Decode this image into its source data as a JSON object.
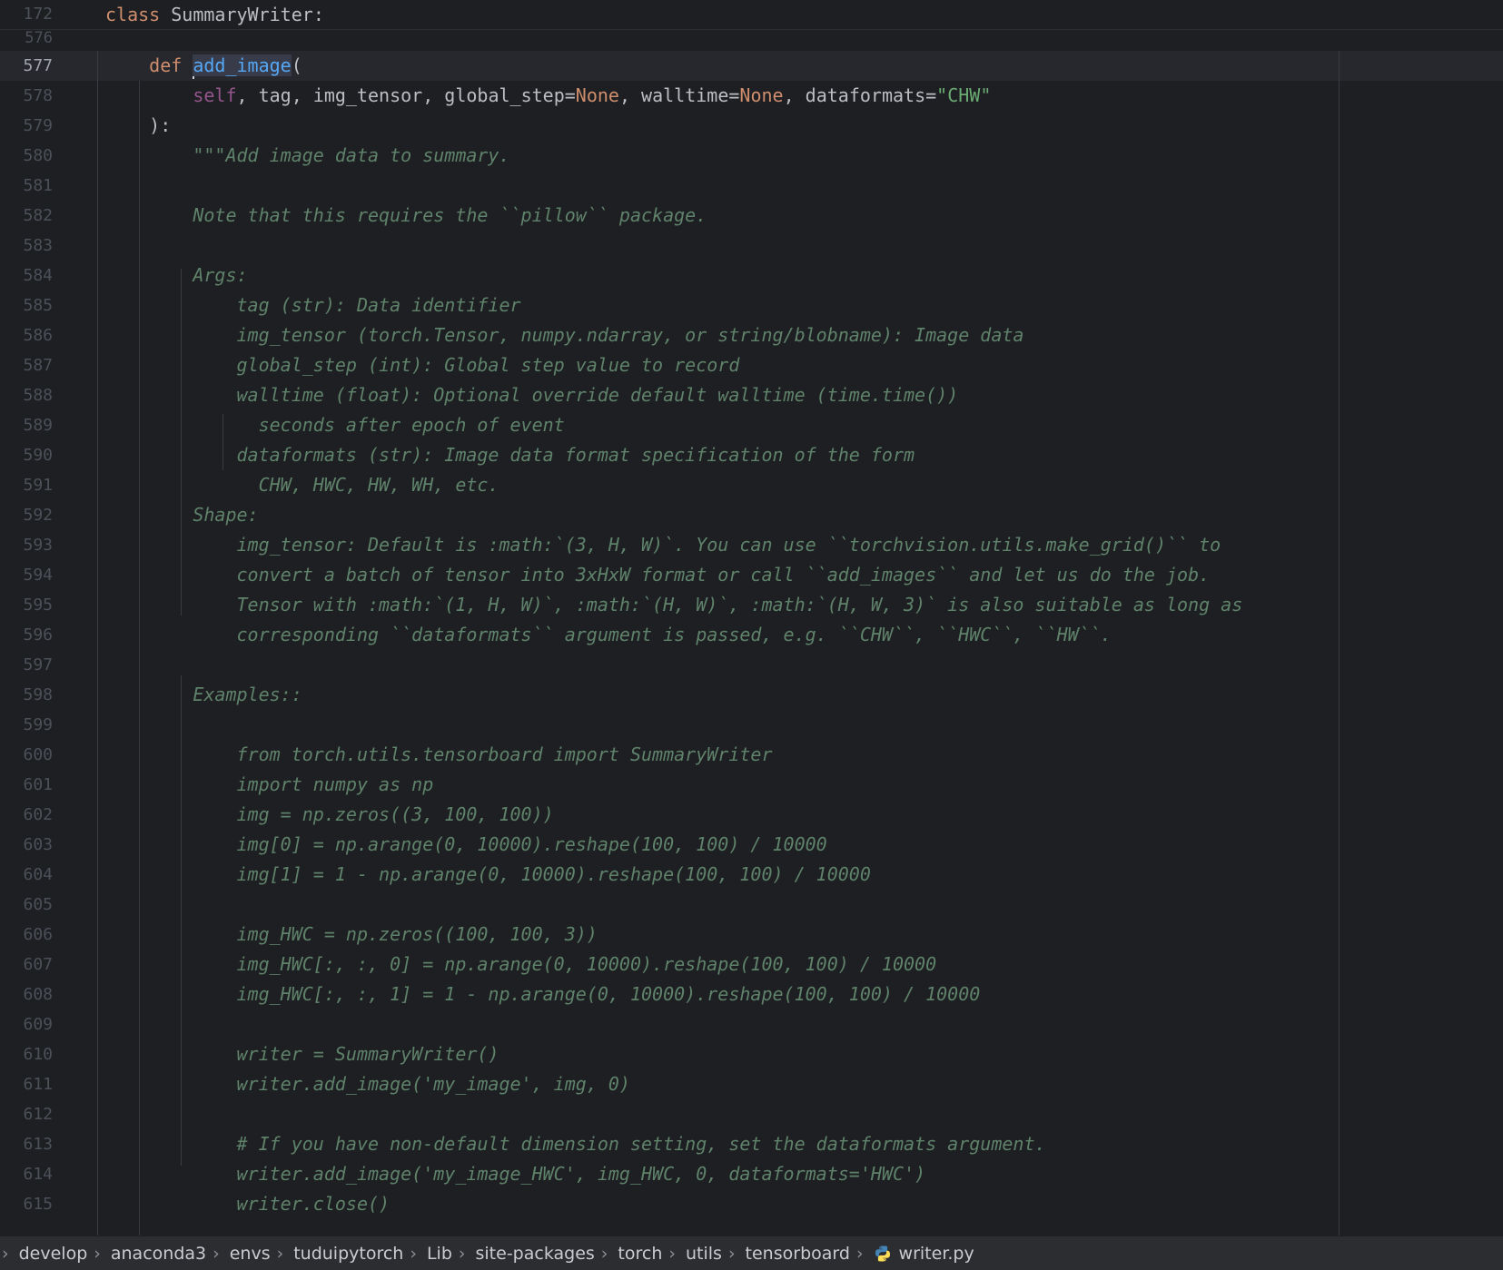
{
  "sticky": {
    "line_number": "172",
    "keyword": "class",
    "name": "SummaryWriter",
    "colon": ":"
  },
  "gap_line_number": "576",
  "lines": [
    {
      "n": "577",
      "current": true,
      "parts": [
        {
          "t": "    "
        },
        {
          "t": "def",
          "c": "kw"
        },
        {
          "t": " "
        },
        {
          "caret": true
        },
        {
          "t": "add_image",
          "c": "fn match"
        },
        {
          "t": "("
        }
      ]
    },
    {
      "n": "578",
      "parts": [
        {
          "t": "        "
        },
        {
          "t": "self",
          "c": "selfk"
        },
        {
          "t": ", tag, img_tensor, global_step="
        },
        {
          "t": "None",
          "c": "none"
        },
        {
          "t": ", walltime="
        },
        {
          "t": "None",
          "c": "none"
        },
        {
          "t": ", dataformats="
        },
        {
          "t": "\"CHW\"",
          "c": "str"
        }
      ]
    },
    {
      "n": "579",
      "parts": [
        {
          "t": "    ):"
        }
      ]
    },
    {
      "n": "580",
      "parts": [
        {
          "t": "        \"\"\"Add image data to summary.",
          "c": "doc"
        }
      ]
    },
    {
      "n": "581",
      "parts": []
    },
    {
      "n": "582",
      "parts": [
        {
          "t": "        Note that this requires the ``pillow`` package.",
          "c": "doc"
        }
      ]
    },
    {
      "n": "583",
      "parts": []
    },
    {
      "n": "584",
      "parts": [
        {
          "t": "        Args:",
          "c": "doc"
        }
      ]
    },
    {
      "n": "585",
      "parts": [
        {
          "t": "            tag (str): Data identifier",
          "c": "doc"
        }
      ]
    },
    {
      "n": "586",
      "parts": [
        {
          "t": "            img_tensor (torch.Tensor, numpy.ndarray, or string/blobname): Image data",
          "c": "doc"
        }
      ]
    },
    {
      "n": "587",
      "parts": [
        {
          "t": "            global_step (int): Global step value to record",
          "c": "doc"
        }
      ]
    },
    {
      "n": "588",
      "parts": [
        {
          "t": "            walltime (float): Optional override default walltime (time.time())",
          "c": "doc"
        }
      ]
    },
    {
      "n": "589",
      "parts": [
        {
          "t": "              seconds after epoch of event",
          "c": "doc"
        }
      ]
    },
    {
      "n": "590",
      "parts": [
        {
          "t": "            dataformats (str): Image data format specification of the form",
          "c": "doc"
        }
      ]
    },
    {
      "n": "591",
      "parts": [
        {
          "t": "              CHW, HWC, HW, WH, etc.",
          "c": "doc"
        }
      ]
    },
    {
      "n": "592",
      "parts": [
        {
          "t": "        Shape:",
          "c": "doc"
        }
      ]
    },
    {
      "n": "593",
      "parts": [
        {
          "t": "            img_tensor: Default is :math:`(3, H, W)`. You can use ``torchvision.utils.make_grid()`` to",
          "c": "doc"
        }
      ]
    },
    {
      "n": "594",
      "parts": [
        {
          "t": "            convert a batch of tensor into 3xHxW format or call ``add_images`` and let us do the job.",
          "c": "doc"
        }
      ]
    },
    {
      "n": "595",
      "parts": [
        {
          "t": "            Tensor with :math:`(1, H, W)`, :math:`(H, W)`, :math:`(H, W, 3)` is also suitable as long as",
          "c": "doc"
        }
      ]
    },
    {
      "n": "596",
      "parts": [
        {
          "t": "            corresponding ``dataformats`` argument is passed, e.g. ``CHW``, ``HWC``, ``HW``.",
          "c": "doc"
        }
      ]
    },
    {
      "n": "597",
      "parts": []
    },
    {
      "n": "598",
      "parts": [
        {
          "t": "        Examples::",
          "c": "doc"
        }
      ]
    },
    {
      "n": "599",
      "parts": []
    },
    {
      "n": "600",
      "parts": [
        {
          "t": "            from torch.utils.tensorboard import SummaryWriter",
          "c": "doc"
        }
      ]
    },
    {
      "n": "601",
      "parts": [
        {
          "t": "            import numpy as np",
          "c": "doc"
        }
      ]
    },
    {
      "n": "602",
      "parts": [
        {
          "t": "            img = np.zeros((3, 100, 100))",
          "c": "doc"
        }
      ]
    },
    {
      "n": "603",
      "parts": [
        {
          "t": "            img[0] = np.arange(0, 10000).reshape(100, 100) / 10000",
          "c": "doc"
        }
      ]
    },
    {
      "n": "604",
      "parts": [
        {
          "t": "            img[1] = 1 - np.arange(0, 10000).reshape(100, 100) / 10000",
          "c": "doc"
        }
      ]
    },
    {
      "n": "605",
      "parts": []
    },
    {
      "n": "606",
      "parts": [
        {
          "t": "            img_HWC = np.zeros((100, 100, 3))",
          "c": "doc"
        }
      ]
    },
    {
      "n": "607",
      "parts": [
        {
          "t": "            img_HWC[:, :, 0] = np.arange(0, 10000).reshape(100, 100) / 10000",
          "c": "doc"
        }
      ]
    },
    {
      "n": "608",
      "parts": [
        {
          "t": "            img_HWC[:, :, 1] = 1 - np.arange(0, 10000).reshape(100, 100) / 10000",
          "c": "doc"
        }
      ]
    },
    {
      "n": "609",
      "parts": []
    },
    {
      "n": "610",
      "parts": [
        {
          "t": "            writer = SummaryWriter()",
          "c": "doc"
        }
      ]
    },
    {
      "n": "611",
      "parts": [
        {
          "t": "            writer.add_image('my_image', img, 0)",
          "c": "doc"
        }
      ]
    },
    {
      "n": "612",
      "parts": []
    },
    {
      "n": "613",
      "parts": [
        {
          "t": "            # If you have non-default dimension setting, set the dataformats argument.",
          "c": "doc"
        }
      ]
    },
    {
      "n": "614",
      "parts": [
        {
          "t": "            writer.add_image('my_image_HWC', img_HWC, 0, dataformats='HWC')",
          "c": "doc"
        }
      ]
    },
    {
      "n": "615",
      "parts": [
        {
          "t": "            writer.close()",
          "c": "doc"
        }
      ]
    }
  ],
  "breadcrumbs": [
    "develop",
    "anaconda3",
    "envs",
    "tuduipytorch",
    "Lib",
    "site-packages",
    "torch",
    "utils",
    "tensorboard"
  ],
  "current_file": {
    "name": "writer.py",
    "icon": "python-file-icon"
  },
  "colors": {
    "background": "#1e1f22",
    "keyword": "#cf8e6d",
    "function": "#56a8f5",
    "string": "#6aab73",
    "docstring": "#5f826b"
  }
}
